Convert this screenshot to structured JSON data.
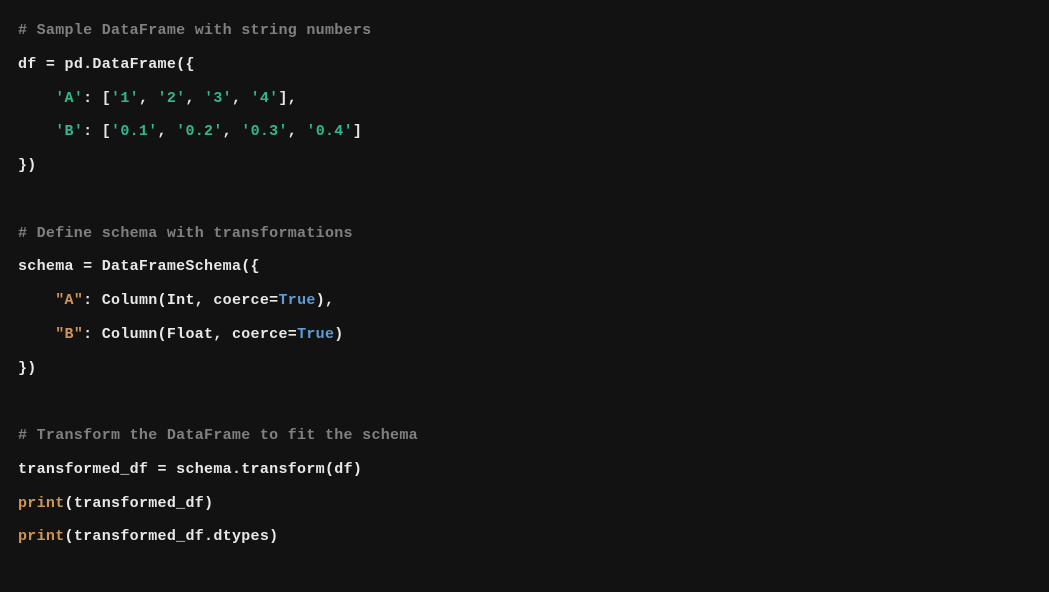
{
  "code": {
    "l1_comment": "# Sample DataFrame with string numbers",
    "l2_df": "df",
    "l2_eq": " = ",
    "l2_pd": "pd.DataFrame(",
    "l2_brace": "{",
    "l3_indent": "    ",
    "l3_key": "'A'",
    "l3_colon": ": [",
    "l3_v1": "'1'",
    "l3_c1": ", ",
    "l3_v2": "'2'",
    "l3_c2": ", ",
    "l3_v3": "'3'",
    "l3_c3": ", ",
    "l3_v4": "'4'",
    "l3_close": "],",
    "l4_indent": "    ",
    "l4_key": "'B'",
    "l4_colon": ": [",
    "l4_v1": "'0.1'",
    "l4_c1": ", ",
    "l4_v2": "'0.2'",
    "l4_c2": ", ",
    "l4_v3": "'0.3'",
    "l4_c3": ", ",
    "l4_v4": "'0.4'",
    "l4_close": "]",
    "l5": "})",
    "l7_comment": "# Define schema with transformations",
    "l8_schema": "schema",
    "l8_eq": " = ",
    "l8_dfs": "DataFrameSchema(",
    "l8_brace": "{",
    "l9_indent": "    ",
    "l9_key": "\"A\"",
    "l9_colon": ": ",
    "l9_col": "Column(Int, coerce=",
    "l9_true": "True",
    "l9_close": "),",
    "l10_indent": "    ",
    "l10_key": "\"B\"",
    "l10_colon": ": ",
    "l10_col": "Column(Float, coerce=",
    "l10_true": "True",
    "l10_close": ")",
    "l11": "})",
    "l13_comment": "# Transform the DataFrame to fit the schema",
    "l14_tdf": "transformed_df",
    "l14_eq": " = ",
    "l14_call": "schema.transform(df)",
    "l15_print": "print",
    "l15_open": "(",
    "l15_arg": "transformed_df",
    "l15_close": ")",
    "l16_print": "print",
    "l16_open": "(",
    "l16_arg": "transformed_df.dtypes",
    "l16_close": ")"
  }
}
